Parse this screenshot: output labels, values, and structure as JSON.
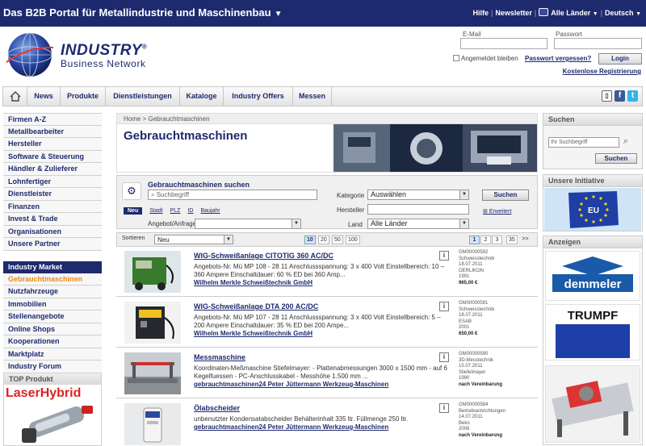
{
  "portal": {
    "title": "Das B2B Portal für Metallindustrie und Maschinenbau",
    "links": [
      "Hilfe",
      "Newsletter"
    ],
    "country_select": "Alle Länder",
    "language_select": "Deutsch"
  },
  "logo": {
    "line1": "INDUSTRY",
    "registered": "®",
    "line2": "Business Network"
  },
  "login": {
    "email_label": "E-Mail",
    "password_label": "Passwort",
    "remember_label": "Angemeldet bleiben",
    "forgot_label": "Passwort vergessen?",
    "button_label": "Login",
    "register_label": "Kostenlose Registrierung"
  },
  "nav": {
    "items": [
      "News",
      "Produkte",
      "Dienstleistungen",
      "Kataloge",
      "Industry Offers",
      "Messen"
    ],
    "social": [
      "mobile-icon",
      "facebook-icon",
      "twitter-icon"
    ]
  },
  "sidebar": {
    "group1": [
      "Firmen A-Z",
      "Metallbearbeiter",
      "Hersteller",
      "Software & Steuerung",
      "Händler & Zulieferer",
      "Lohnfertiger",
      "Dienstleister",
      "Finanzen",
      "Invest & Trade",
      "Organisationen",
      "Unsere Partner"
    ],
    "market_head": "Industry Market",
    "group2": [
      "Gebrauchtmaschinen",
      "Nutzfahrzeuge",
      "Immobilien",
      "Stellenangebote",
      "Online Shops",
      "Kooperationen",
      "Marktplatz",
      "Industry Forum"
    ],
    "top_product_head": "TOP Produkt",
    "top_product_name": "LaserHybrid"
  },
  "breadcrumb": {
    "home": "Home",
    "sep": ">",
    "current": "Gebrauchtmaschinen"
  },
  "page_title": "Gebrauchtmaschinen",
  "search": {
    "title": "Gebrauchtmaschinen suchen",
    "keyword_placeholder": "Suchbegriff",
    "tabs": [
      "Neu",
      "Stadt",
      "PLZ",
      "ID",
      "Baujahr"
    ],
    "kategorie_label": "Kategorie",
    "kategorie_value": "Auswählen",
    "hersteller_label": "Hersteller",
    "land_label": "Land",
    "land_value": "Alle Länder",
    "angebot_label": "Angebot/Anfrage",
    "button_label": "Suchen",
    "advanced_label": "Erweitert"
  },
  "sortbar": {
    "label": "Sortieren",
    "value": "Neu",
    "per_page": [
      "10",
      "20",
      "50",
      "100"
    ],
    "pages": [
      "1",
      "2",
      "3",
      "...",
      "35",
      ">>"
    ]
  },
  "listings": [
    {
      "title": "WIG-Schweißanlage CITOTIG 360 AC/DC",
      "desc": "Angebots-Nr. Mü MP 108 - 28 11 Anschlussspannung: 3 x 400 Volt Einstellbereich: 10 – 360 Ampere Einschaltdauer: 60 % ED bei 360 Amp...",
      "seller": "Wilhelm Merkle Schweißtechnik GmbH",
      "meta": [
        "GM00000592",
        "Schweisstechnik",
        "18.07.2011",
        "OERLIKON",
        "1991"
      ],
      "price": "965,00 €"
    },
    {
      "title": "WIG-Schweißanlage DTA 200 AC/DC",
      "desc": "Angebots-Nr. Mü MP 107 - 28 11 Anschlussspannung: 3 x 400 Volt Einstellbereich: 5 – 200 Ampere Einschaltdauer: 35 % ED bei 200 Ampe...",
      "seller": "Wilhelm Merkle Schweißtechnik GmbH",
      "meta": [
        "GM00000591",
        "Schweisstechnik",
        "18.07.2011",
        "ESAB",
        "2001"
      ],
      "price": "650,00 €"
    },
    {
      "title": "Messmaschine",
      "desc": "Koordinaten-Meßmaschine Stiefelmayer: - Plattenabmessungen 3000 x 1500 mm - auf 6 Kegelfuessen - PC-Anschlusskabel - Messhöhe 1.500 mm ...",
      "seller": "gebrauchtmaschinen24 Peter Jüttermann Werkzeug-Maschinen",
      "meta": [
        "GM00000590",
        "3D-Messtechnik",
        "15.07.2011",
        "Stiefelmayer",
        "1990"
      ],
      "price": "nach Vereinbarung"
    },
    {
      "title": "Ölabscheider",
      "desc": "unbenutzter Kondensatabscheider Behälterinhalt 335 ltr. Füllmenge 250 ltr.",
      "seller": "gebrauchtmaschinen24 Peter Jüttermann Werkzeug-Maschinen",
      "meta": [
        "GM00000584",
        "Betriebseinrichtungen",
        "14.07.2011",
        "Beko",
        "2008"
      ],
      "price": "nach Vereinbarung"
    }
  ],
  "right": {
    "search_head": "Suchen",
    "search_placeholder": "Ihr Suchbegriff",
    "search_button": "Suchen",
    "initiative_head": "Unsere Initiative",
    "eu_label": "EU",
    "ads_head": "Anzeigen",
    "ads": [
      "demmeler",
      "TRUMPF"
    ]
  },
  "colors": {
    "brand_navy": "#1e2a6e",
    "active_orange": "#e8891a",
    "demmeler_blue": "#1a5aa8",
    "trumpf_blue": "#1e3fa8"
  }
}
